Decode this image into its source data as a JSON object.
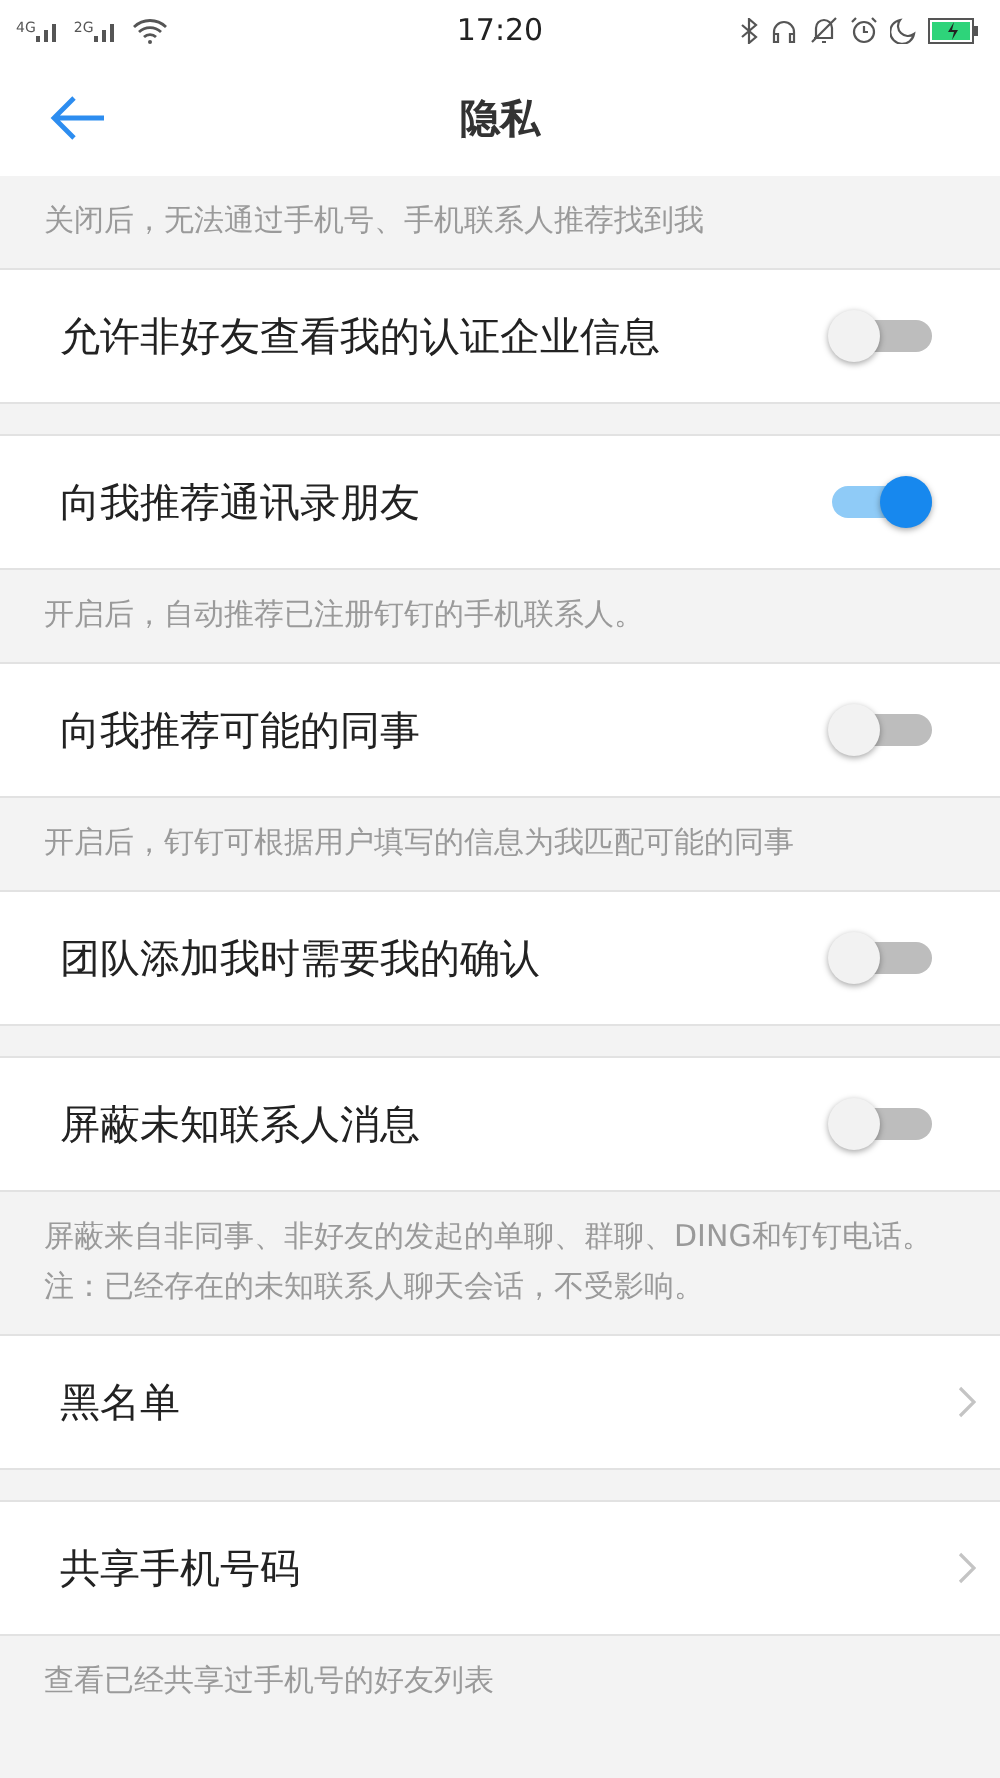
{
  "status_bar": {
    "signals": [
      "4G",
      "2G"
    ],
    "time": "17:20"
  },
  "header": {
    "title": "隐私"
  },
  "items": [
    {
      "kind": "note",
      "text": "关闭后，无法通过手机号、手机联系人推荐找到我"
    },
    {
      "kind": "toggle",
      "label": "允许非好友查看我的认证企业信息",
      "on": false
    },
    {
      "kind": "gap"
    },
    {
      "kind": "toggle",
      "label": "向我推荐通讯录朋友",
      "on": true
    },
    {
      "kind": "note",
      "text": "开启后，自动推荐已注册钉钉的手机联系人。"
    },
    {
      "kind": "toggle",
      "label": "向我推荐可能的同事",
      "on": false
    },
    {
      "kind": "note",
      "text": "开启后，钉钉可根据用户填写的信息为我匹配可能的同事"
    },
    {
      "kind": "toggle",
      "label": "团队添加我时需要我的确认",
      "on": false
    },
    {
      "kind": "gap"
    },
    {
      "kind": "toggle",
      "label": "屏蔽未知联系人消息",
      "on": false
    },
    {
      "kind": "note",
      "text": "屏蔽来自非同事、非好友的发起的单聊、群聊、DING和钉钉电话。注：已经存在的未知联系人聊天会话，不受影响。"
    },
    {
      "kind": "link",
      "label": "黑名单"
    },
    {
      "kind": "gap"
    },
    {
      "kind": "link",
      "label": "共享手机号码"
    },
    {
      "kind": "note",
      "text": "查看已经共享过手机号的好友列表"
    }
  ]
}
